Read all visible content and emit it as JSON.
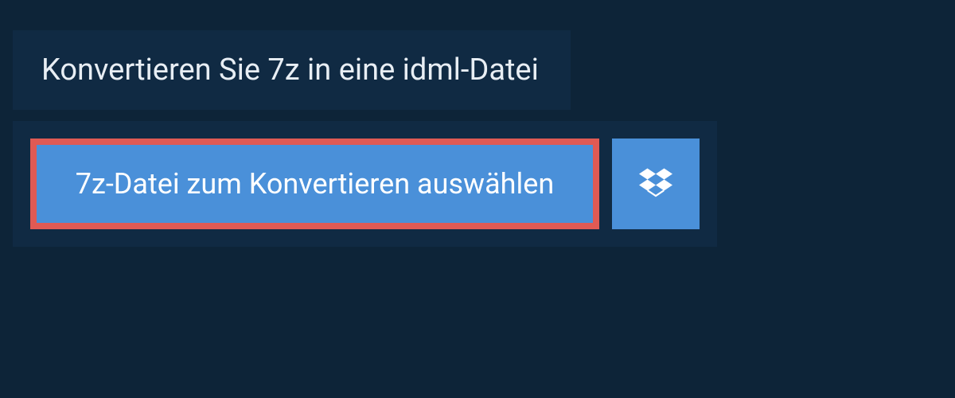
{
  "header": {
    "title": "Konvertieren Sie 7z in eine idml-Datei"
  },
  "upload": {
    "select_file_label": "7z-Datei zum Konvertieren auswählen"
  },
  "colors": {
    "background": "#0d2438",
    "panel": "#102a43",
    "button": "#4a90d9",
    "highlight_border": "#e05a54",
    "text_light": "#e8eef4",
    "text_white": "#ffffff"
  }
}
